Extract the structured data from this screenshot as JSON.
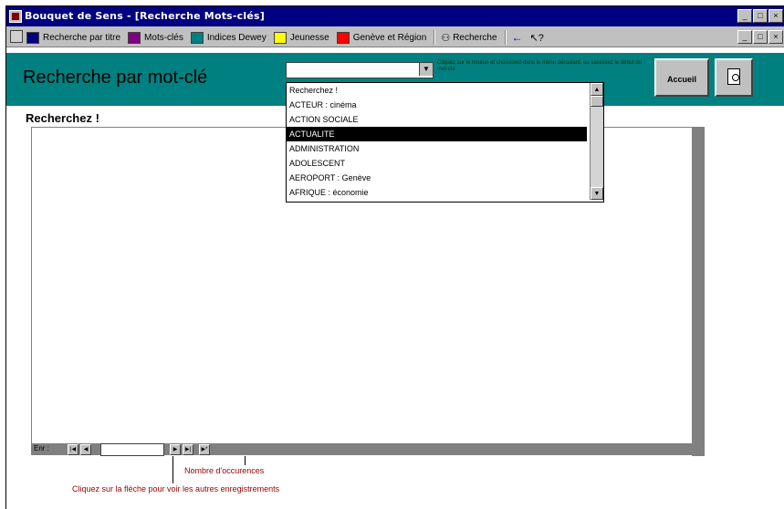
{
  "window": {
    "title": "Bouquet de Sens - [Recherche Mots-clés]",
    "controls": [
      "_",
      "□",
      "×"
    ]
  },
  "menubar": {
    "items": [
      {
        "label": "Recherche par titre",
        "color": "#000080"
      },
      {
        "label": "Mots-clés",
        "color": "#800080"
      },
      {
        "label": "Indices Dewey",
        "color": "#008080"
      },
      {
        "label": "Jeunesse",
        "color": "#ffff00"
      },
      {
        "label": "Genève et Région",
        "color": "#ff0000"
      }
    ],
    "search_label": "Recherche",
    "back_arrow": "🡐",
    "binoculars": "🔭"
  },
  "header": {
    "title": "Recherche par mot-clé",
    "combo_value": "",
    "hint": "Cliquez sur le bouton et choisissez dans le menu déroulant, ou saisissez le début du mot-clé",
    "accueil_label": "Accueil"
  },
  "body": {
    "section_title": "Recherchez !"
  },
  "dropdown": {
    "items": [
      "Recherchez !",
      "ACTEUR : cinéma",
      "ACTION SOCIALE",
      "ACTUALITE",
      "ADMINISTRATION",
      "ADOLESCENT",
      "AEROPORT : Genève",
      "AFRIQUE : économie"
    ],
    "selected_index": 3
  },
  "navbar": {
    "label": "Enr :",
    "record_value": ""
  },
  "callouts": {
    "occurrences": "Nombre d'occurences",
    "arrow_hint": "Cliquez sur la flèche pour voir les autres enregistrements"
  },
  "colors": {
    "title_bar": "#000080",
    "header": "#008080",
    "callout_text": "#990000"
  }
}
